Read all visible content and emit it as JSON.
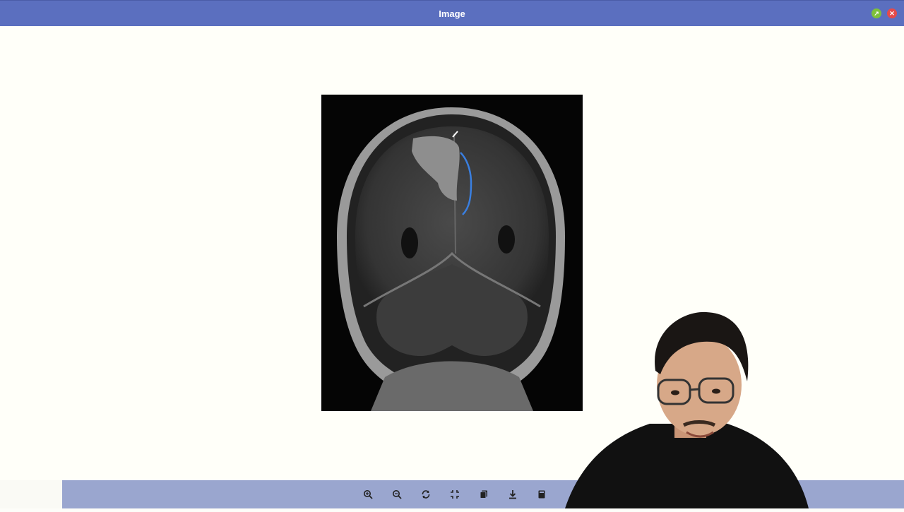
{
  "window": {
    "title": "Image",
    "expand_icon": "expand-icon",
    "close_icon": "close-icon"
  },
  "colors": {
    "titlebar": "#5b6fbf",
    "toolbar": "#9aa6cf",
    "annotation": "#3a7fe0"
  },
  "toolbar": {
    "tools": [
      "zoom-in-icon",
      "zoom-out-icon",
      "rotate-icon",
      "fit-screen-icon",
      "copy-icon",
      "download-icon",
      "book-icon"
    ]
  }
}
